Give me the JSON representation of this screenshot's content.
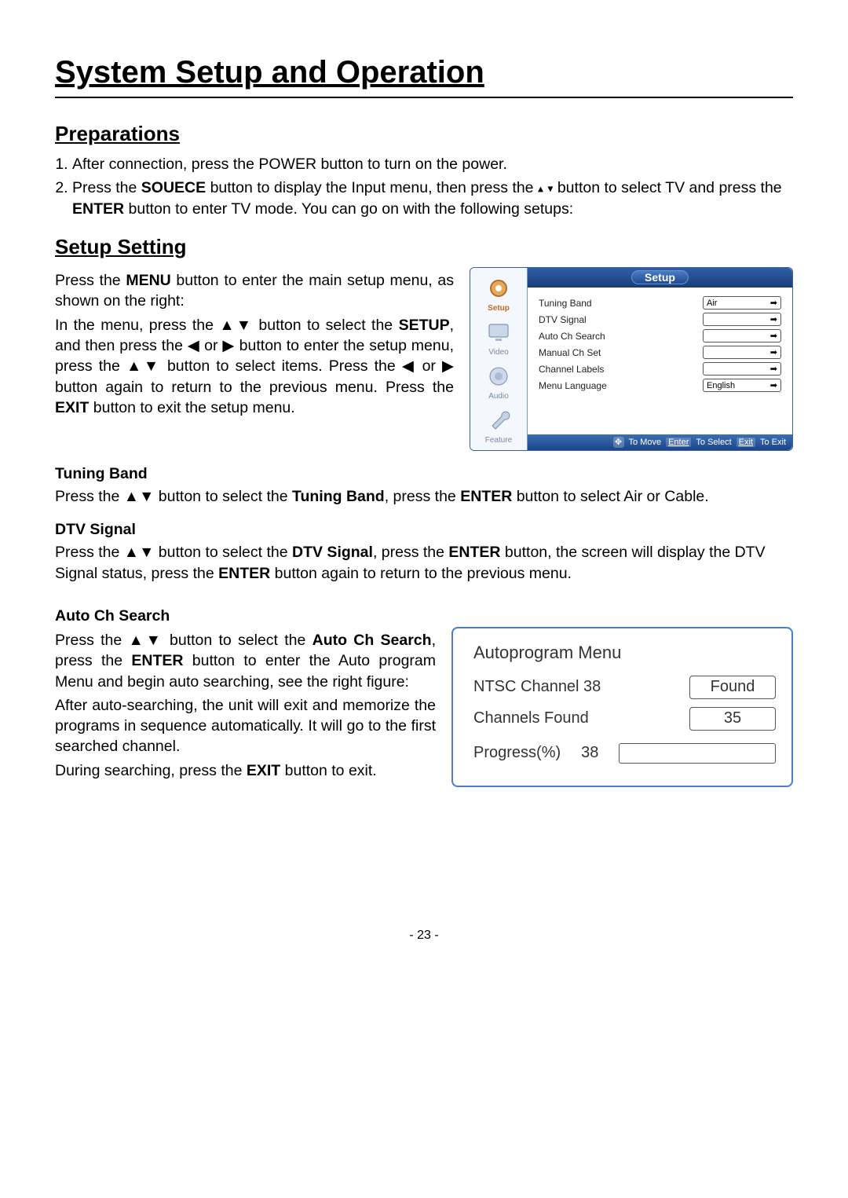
{
  "title": "System Setup and Operation",
  "sections": {
    "preparations": "Preparations",
    "setup_setting": "Setup Setting"
  },
  "prep_item1": "After connection, press the POWER button to turn on the power.",
  "prep_item2a": "Press the ",
  "prep_item2_bold1": "SOUECE",
  "prep_item2b": " button to display the Input menu, then press the ",
  "prep_item2c": " button to select TV and press the ",
  "prep_item2_bold2": "ENTER",
  "prep_item2d": " button to enter TV mode. You can go on with the following setups:",
  "setup_para1a": "Press the ",
  "setup_para1_bold1": "MENU",
  "setup_para1b": " button to enter the main setup menu, as shown on the right:",
  "setup_para2a": "In the menu, press the ▲▼ button to select the ",
  "setup_para2_bold1": "SETUP",
  "setup_para2b": ", and then press the ◀ or ▶ button to enter the setup menu, press the ▲▼ button to select items. Press the ◀ or ▶ button again to return to the previous menu. Press the ",
  "setup_para2_bold2": "EXIT",
  "setup_para2c": " button to exit the setup menu.",
  "subheads": {
    "tuning_band": "Tuning Band",
    "dtv_signal": "DTV Signal",
    "auto_ch": "Auto Ch Search"
  },
  "tuning_text_a": "Press the ▲▼ button to select the ",
  "tuning_text_bold": "Tuning Band",
  "tuning_text_b": ", press the ",
  "tuning_text_bold2": "ENTER",
  "tuning_text_c": " button to select Air or Cable.",
  "dtv_text_a": "Press the ▲▼ button to select the ",
  "dtv_text_bold": "DTV Signal",
  "dtv_text_b": ", press the ",
  "dtv_text_bold2": "ENTER",
  "dtv_text_c": " button, the screen will display the DTV Signal status, press the ",
  "dtv_text_bold3": "ENTER",
  "dtv_text_d": " button again to return to the previous menu.",
  "auto_text_a": "Press the ▲▼ button to select the ",
  "auto_text_bold1": "Auto Ch Search",
  "auto_text_b": ", press the ",
  "auto_text_bold2": "ENTER",
  "auto_text_c": " button to enter the Auto program Menu and begin auto searching, see the right figure:",
  "auto_text_p2": "After auto-searching, the unit will exit and memorize the programs in sequence automatically. It will go to the first searched channel.",
  "auto_text_p3a": "During searching, press the ",
  "auto_text_p3_bold": "EXIT",
  "auto_text_p3b": " button to exit.",
  "osd": {
    "title": "Setup",
    "sidebar": {
      "setup": "Setup",
      "video": "Video",
      "audio": "Audio",
      "feature": "Feature"
    },
    "rows": [
      {
        "label": "Tuning Band",
        "value": "Air"
      },
      {
        "label": "DTV Signal",
        "value": ""
      },
      {
        "label": "Auto Ch Search",
        "value": ""
      },
      {
        "label": "Manual Ch Set",
        "value": ""
      },
      {
        "label": "Channel Labels",
        "value": ""
      },
      {
        "label": "Menu Language",
        "value": "English"
      }
    ],
    "footer": {
      "move": "To Move",
      "enter": "Enter",
      "select": "To Select",
      "exit": "Exit",
      "toexit": "To Exit"
    }
  },
  "autoprogram": {
    "title": "Autoprogram Menu",
    "row1_label": "NTSC Channel 38",
    "row1_value": "Found",
    "row2_label": "Channels Found",
    "row2_value": "35",
    "progress_label": "Progress(%)",
    "progress_value": "38"
  },
  "page_number": "- 23 -"
}
